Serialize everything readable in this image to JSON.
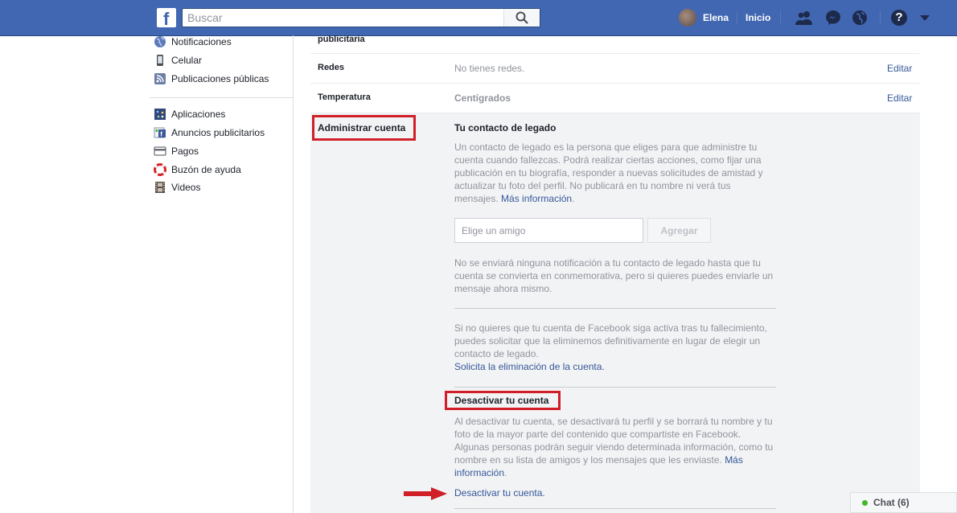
{
  "topbar": {
    "search_placeholder": "Buscar",
    "user_name": "Elena",
    "home_label": "Inicio",
    "help_glyph": "?",
    "logo_glyph": "f",
    "brand_color": "#4267b2"
  },
  "leftnav": {
    "group1": [
      {
        "label": "Notificaciones",
        "icon": "globe-icon"
      },
      {
        "label": "Celular",
        "icon": "phone-icon"
      },
      {
        "label": "Publicaciones públicas",
        "icon": "rss-icon"
      }
    ],
    "group2": [
      {
        "label": "Aplicaciones",
        "icon": "apps-icon"
      },
      {
        "label": "Anuncios publicitarios",
        "icon": "ads-icon"
      },
      {
        "label": "Pagos",
        "icon": "card-icon"
      },
      {
        "label": "Buzón de ayuda",
        "icon": "lifebuoy-icon"
      },
      {
        "label": "Videos",
        "icon": "film-icon"
      }
    ]
  },
  "settings": {
    "partial_label": "publicitaria",
    "rows": [
      {
        "label": "Redes",
        "value": "No tienes redes.",
        "edit": "Editar"
      },
      {
        "label": "Temperatura",
        "value": "Centígrados",
        "edit": "Editar"
      }
    ],
    "manage": {
      "label": "Administrar cuenta",
      "legacy_title": "Tu contacto de legado",
      "legacy_desc": "Un contacto de legado es la persona que eliges para que administre tu cuenta cuando fallezcas. Podrá realizar ciertas acciones, como fijar una publicación en tu biografía, responder a nuevas solicitudes de amistad y actualizar tu foto del perfil. No publicará en tu nombre ni verá tus mensajes.",
      "more_info": "Más información",
      "friend_placeholder": "Elige un amigo",
      "add_label": "Agregar",
      "notice": "No se enviará ninguna notificación a tu contacto de legado hasta que tu cuenta se convierta en conmemorativa, pero si quieres puedes enviarle un mensaje ahora mismo.",
      "delete_desc": "Si no quieres que tu cuenta de Facebook siga activa tras tu fallecimiento, puedes solicitar que la eliminemos definitivamente en lugar de elegir un contacto de legado.",
      "delete_link": "Solicita la eliminación de la cuenta.",
      "deactivate_title": "Desactivar tu cuenta",
      "deactivate_desc": "Al desactivar tu cuenta, se desactivará tu perfil y se borrará tu nombre y tu foto de la mayor parte del contenido que compartiste en Facebook. Algunas personas podrán seguir viendo determinada información, como tu nombre en su lista de amigos y los mensajes que les enviaste.",
      "more_info2": "Más información",
      "deactivate_link": "Desactivar tu cuenta."
    }
  },
  "chat": {
    "label": "Chat (6)"
  },
  "colors": {
    "highlight": "#d01f28",
    "link": "#365899"
  }
}
